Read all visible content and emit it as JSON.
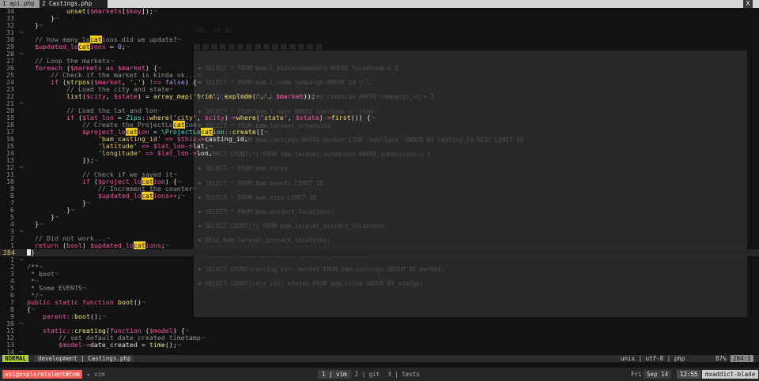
{
  "tabs": [
    {
      "label": "1 api.php"
    },
    {
      "label": "2 Castings.php"
    }
  ],
  "tab_close_label": "X",
  "overlay": {
    "ghost_tab": "SQL  CF SG",
    "lines": [
      "SELECT * FROM bam.l_blockedmembers WHERE talentnum = 0",
      "SELECT * FROM bam.l_camp campaign WHERE id = 1",
      "SELECT * FROM bam.l_sch scheduled_campaign WHERE campaign_id = 1",
      "SELECT * FROM bam.l_user WHERE username = 'jdoe'",
      "SELECT * FROM bam.laravel_schedules",
      "SELECT * FROM bam.castings WHERE market LIKE '%dallas%' ORDER BY casting_id DESC LIMIT 10",
      "SELECT COUNT(*) FROM bam.laravel_schedules WHERE submission = 1",
      "SELECT * FROM bam.forms;",
      "SELECT * FROM bam.events LIMIT 10",
      "SELECT * FROM bam.zips LIMIT 10",
      "SELECT * FROM bam.project_locations;",
      "SELECT COUNT(*) FROM bam.laravel_project_locations;",
      "DESC bam.laravel_project_locations;",
      "TRUNCATE TABLE bam.laravel_project_locations;",
      "SELECT COUNT(casting_id), market FROM bam.castings GROUP BY market;",
      "SELECT COUNT(role_id), status FROM bam.roles GROUP BY status;"
    ]
  },
  "code_top": [
    {
      "num": "34",
      "html": "            <span class='f'>unset</span><span class='p'>(</span><span class='v'>$markets</span><span class='p'>[</span><span class='v'>$key</span><span class='p'>]);</span><span class='tl'>¬</span>"
    },
    {
      "num": "33",
      "html": "        <span class='p'>}</span><span class='tl'>¬</span>"
    },
    {
      "num": "32",
      "html": "    <span class='p'>}</span><span class='tl'>¬</span>"
    },
    {
      "num": "31",
      "html": "<span class='tl'>¬</span>"
    },
    {
      "num": "30",
      "html": "    <span class='c'>// how many lo</span><span class='hl'>cat</span><span class='c'>ions did we update?</span><span class='tl'>¬</span>"
    },
    {
      "num": "29",
      "html": "    <span class='v'>$updated_lo</span><span class='hl'>cat</span><span class='v'>ions</span><span class='p'> = </span><span class='n'>0</span><span class='p'>;</span><span class='tl'>¬</span>"
    },
    {
      "num": "28",
      "html": "<span class='tl'>¬</span>"
    },
    {
      "num": "27",
      "html": "    <span class='c'>// Loop the markets</span><span class='tl'>¬</span>"
    },
    {
      "num": "26",
      "html": "    <span class='k'>foreach</span><span class='p'> (</span><span class='v'>$markets</span><span class='k'> as </span><span class='v'>$market</span><span class='p'>) {</span><span class='tl'>¬</span>"
    },
    {
      "num": "25",
      "html": "        <span class='c'>// Check if the market is kinda ok...</span><span class='tl'>¬</span>"
    },
    {
      "num": "24",
      "html": "        <span class='k'>if</span><span class='p'> (</span><span class='f'>strpos</span><span class='p'>(</span><span class='v'>$market</span><span class='p'>, </span><span class='s'>','</span><span class='p'>) </span><span class='k'>!==</span><span class='n'> false</span><span class='p'>) {</span><span class='tl'>¬</span>"
    },
    {
      "num": "23",
      "html": "            <span class='c'>// Load the city and state</span><span class='tl'>¬</span>"
    },
    {
      "num": "22",
      "html": "            <span class='f'>list</span><span class='p'>(</span><span class='v'>$city</span><span class='p'>, </span><span class='v'>$state</span><span class='p'>) = </span><span class='f'>array_map</span><span class='p'>(</span><span class='s'>'trim'</span><span class='p'>, </span><span class='f'>explode</span><span class='p'>(</span><span class='s'>','</span><span class='p'>, </span><span class='v'>$market</span><span class='p'>));</span><span class='tl'>¬</span>"
    },
    {
      "num": "21",
      "html": "<span class='tl'>¬</span>"
    },
    {
      "num": "20",
      "html": "            <span class='c'>// Load the lat and lon</span><span class='tl'>¬</span>"
    },
    {
      "num": "19",
      "html": "            <span class='k'>if</span><span class='p'> (</span><span class='v'>$lat_lon</span><span class='p'> = </span><span class='t'>Zips</span><span class='k'>::</span><span class='f'>where</span><span class='p'>(</span><span class='s'>'city'</span><span class='p'>, </span><span class='v'>$city</span><span class='p'>)</span><span class='k'>-&gt;</span><span class='f'>where</span><span class='p'>(</span><span class='s'>'state'</span><span class='p'>, </span><span class='v'>$state</span><span class='p'>)</span><span class='k'>-&gt;</span><span class='f'>first</span><span class='p'>()) {</span><span class='tl'>¬</span>"
    },
    {
      "num": "18",
      "html": "                <span class='c'>// Create the ProjectLo</span><span class='hl'>cat</span><span class='c'>ion</span><span class='tl'>¬</span>"
    },
    {
      "num": "17",
      "html": "                <span class='v'>$project_lo</span><span class='hl'>cat</span><span class='v'>ion</span><span class='p'> = </span><span class='t'>\\ProjectLo</span><span class='hl'>cat</span><span class='t'>ion</span><span class='k'>::</span><span class='f'>create</span><span class='p'>([</span><span class='tl'>¬</span>"
    },
    {
      "num": "16",
      "html": "                    <span class='s'>'bam_casting_id'</span><span class='k'> =&gt; </span><span class='v'>$this</span><span class='k'>-&gt;</span><span class='p'>casting_id,</span><span class='tl'>¬</span>"
    },
    {
      "num": "15",
      "html": "                    <span class='s'>'latitude'</span><span class='k'> =&gt; </span><span class='v'>$lat_lon</span><span class='k'>-&gt;</span><span class='p'>lat,</span><span class='tl'>¬</span>"
    },
    {
      "num": "14",
      "html": "                    <span class='s'>'longitude'</span><span class='k'> =&gt; </span><span class='v'>$lat_lon</span><span class='k'>-&gt;</span><span class='p'>lon,</span><span class='tl'>¬</span>"
    },
    {
      "num": "13",
      "html": "                <span class='p'>]);</span><span class='tl'>¬</span>"
    },
    {
      "num": "12",
      "html": "<span class='tl'>¬</span>"
    },
    {
      "num": "11",
      "html": "                <span class='c'>// Check if we saved it</span><span class='tl'>¬</span>"
    },
    {
      "num": "10",
      "html": "                <span class='k'>if</span><span class='p'> (</span><span class='v'>$project_lo</span><span class='hl'>cat</span><span class='v'>ion</span><span class='p'>) {</span><span class='tl'>¬</span>"
    },
    {
      "num": "9",
      "html": "                    <span class='c'>// Increment the counter</span><span class='tl'>¬</span>"
    },
    {
      "num": "8",
      "html": "                    <span class='v'>$updated_lo</span><span class='hl'>cat</span><span class='v'>ions</span><span class='k'>++</span><span class='p'>;</span><span class='tl'>¬</span>"
    },
    {
      "num": "7",
      "html": "                <span class='p'>}</span><span class='tl'>¬</span>"
    },
    {
      "num": "6",
      "html": "            <span class='p'>}</span><span class='tl'>¬</span>"
    },
    {
      "num": "5",
      "html": "        <span class='p'>}</span><span class='tl'>¬</span>"
    },
    {
      "num": "4",
      "html": "    <span class='p'>}</span><span class='tl'>¬</span>"
    },
    {
      "num": "3",
      "html": "<span class='tl'>¬</span>"
    },
    {
      "num": "2",
      "html": "    <span class='c'>// Did not work...</span><span class='tl'>¬</span>"
    },
    {
      "num": "1",
      "html": "    <span class='k'>return</span><span class='p'> (</span><span class='k'>bool</span><span class='p'>) </span><span class='v'>$updated_lo</span><span class='hl'>cat</span><span class='v'>ions</span><span class='p'>;</span><span class='tl'>¬</span>"
    }
  ],
  "current_line": {
    "num": "284",
    "text": "}"
  },
  "code_bottom": [
    {
      "num": "1",
      "html": "<span class='tl'>¬</span>"
    },
    {
      "num": "2",
      "html": "  <span class='c'>/**</span><span class='tl'>¬</span>"
    },
    {
      "num": "3",
      "html": "  <span class='c'> * boot</span><span class='tl'>¬</span>"
    },
    {
      "num": "4",
      "html": "  <span class='c'> *</span><span class='tl'>¬</span>"
    },
    {
      "num": "5",
      "html": "  <span class='c'> * Some EVENTS</span><span class='tl'>¬</span>"
    },
    {
      "num": "6",
      "html": "  <span class='c'> */</span><span class='tl'>¬</span>"
    },
    {
      "num": "7",
      "html": "  <span class='k'>public static function</span><span class='f'> boot</span><span class='p'>()</span><span class='tl'>¬</span>"
    },
    {
      "num": "8",
      "html": "  <span class='p'>{</span><span class='tl'>¬</span>"
    },
    {
      "num": "9",
      "html": "      <span class='k'>parent</span><span class='k'>::</span><span class='f'>boot</span><span class='p'>();</span><span class='tl'>¬</span>"
    },
    {
      "num": "10",
      "html": "<span class='tl'>¬</span>"
    },
    {
      "num": "11",
      "html": "      <span class='k'>static</span><span class='k'>::</span><span class='f'>creating</span><span class='p'>(</span><span class='k'>function</span><span class='p'> (</span><span class='v'>$model</span><span class='p'>) {</span><span class='tl'>¬</span>"
    },
    {
      "num": "12",
      "html": "          <span class='c'>// set default date_created timetamp</span><span class='tl'>¬</span>"
    },
    {
      "num": "13",
      "html": "          <span class='v'>$model</span><span class='k'>-&gt;</span><span class='p'>date_created = </span><span class='f'>time</span><span class='p'>();</span><span class='tl'>¬</span>"
    },
    {
      "num": "14",
      "html": "<span class='tl'>¬</span>"
    }
  ],
  "statusline": {
    "mode": "NORMAL",
    "branch_file": "development | Castings.php",
    "format": "unix | utf-8 | php",
    "percent": "87%",
    "position": "284:1"
  },
  "tmux": {
    "session": "api@exploretalent#com",
    "small_window": "vim",
    "windows": [
      {
        "label": "1 | vim",
        "active": true
      },
      {
        "label": "2 | git",
        "active": false
      },
      {
        "label": "3 | tests",
        "active": false
      }
    ],
    "day": "Fri",
    "date": "Sep 14",
    "time": "12:55",
    "host": "mxaddict-blade"
  }
}
